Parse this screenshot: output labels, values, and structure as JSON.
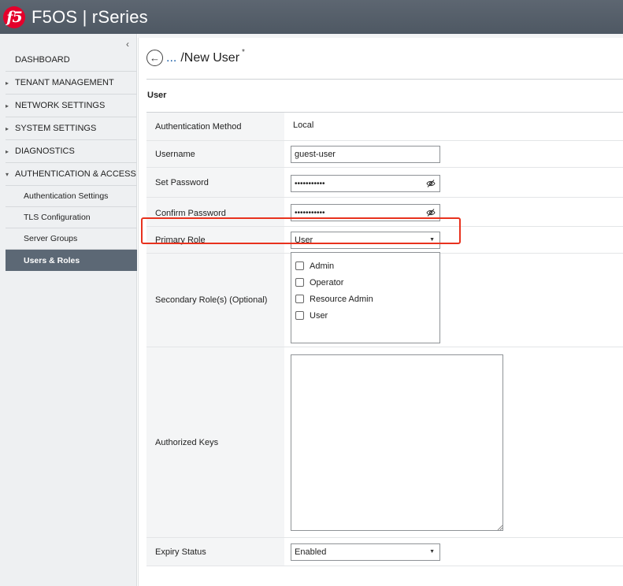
{
  "header": {
    "logo_text": "f5",
    "title": "F5OS | rSeries"
  },
  "sidebar": {
    "collapse_glyph": "‹",
    "items": [
      {
        "label": "DASHBOARD",
        "has_caret": false
      },
      {
        "label": "TENANT MANAGEMENT",
        "has_caret": true,
        "caret": "▸"
      },
      {
        "label": "NETWORK SETTINGS",
        "has_caret": true,
        "caret": "▸"
      },
      {
        "label": "SYSTEM SETTINGS",
        "has_caret": true,
        "caret": "▸"
      },
      {
        "label": "DIAGNOSTICS",
        "has_caret": true,
        "caret": "▸"
      },
      {
        "label": "AUTHENTICATION & ACCESS",
        "has_caret": true,
        "caret": "▾"
      }
    ],
    "sub_items": [
      {
        "label": "Authentication Settings"
      },
      {
        "label": "TLS Configuration"
      },
      {
        "label": "Server Groups"
      },
      {
        "label": "Users & Roles",
        "active": true
      }
    ]
  },
  "page": {
    "back_glyph": "←",
    "breadcrumb_link": "...",
    "title": "/New User",
    "required_marker": "*",
    "section_title": "User"
  },
  "form": {
    "auth_method": {
      "label": "Authentication Method",
      "value": "Local"
    },
    "username": {
      "label": "Username",
      "value": "guest-user"
    },
    "set_password": {
      "label": "Set Password",
      "value": "•••••••••••"
    },
    "confirm_password": {
      "label": "Confirm Password",
      "value": "•••••••••••"
    },
    "primary_role": {
      "label": "Primary Role",
      "value": "User"
    },
    "secondary_roles": {
      "label": "Secondary Role(s) (Optional)",
      "options": [
        "Admin",
        "Operator",
        "Resource Admin",
        "User"
      ]
    },
    "authorized_keys": {
      "label": "Authorized Keys",
      "value": ""
    },
    "expiry_status": {
      "label": "Expiry Status",
      "value": "Enabled"
    }
  },
  "colors": {
    "header_bg": "#56606b",
    "active_nav_bg": "#5c6875",
    "link": "#1a5ea8",
    "highlight": "#e8321e",
    "logo": "#e4002b"
  }
}
